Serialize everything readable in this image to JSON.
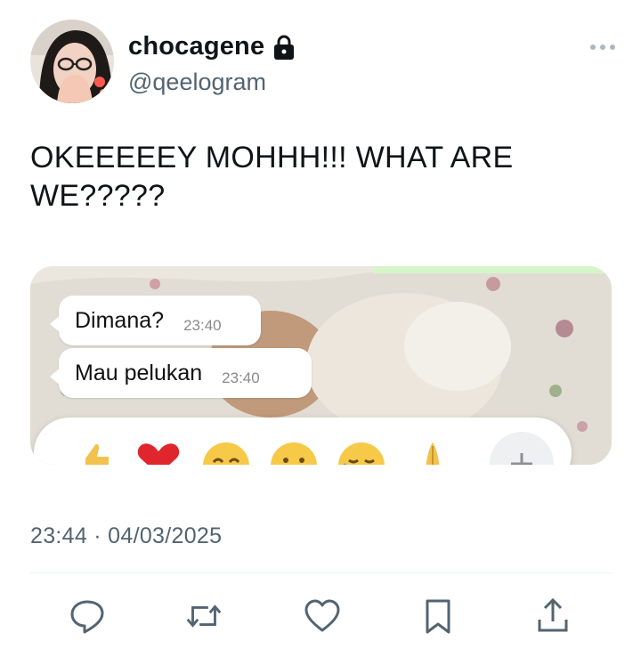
{
  "author": {
    "display_name": "chocagene",
    "handle": "@qeelogram",
    "avatar_icon": "avatar-photo",
    "protected_icon": "lock-icon"
  },
  "tweet": {
    "text": "OKEEEEEY MOHHH!!! WHAT ARE WE?????",
    "timestamp": "23:44 · 04/03/2025"
  },
  "media": {
    "messages": [
      {
        "text": "Dimana?",
        "time": "23:40"
      },
      {
        "text": "Mau pelukan",
        "time": "23:40"
      }
    ],
    "reactions": [
      "thumbs-up",
      "heart",
      "joy",
      "open-mouth",
      "crying",
      "folded-hands",
      "plus"
    ]
  },
  "actions": [
    "reply-icon",
    "retweet-icon",
    "like-icon",
    "bookmark-icon",
    "share-icon"
  ],
  "colors": {
    "text": "#0f1419",
    "secondary": "#536471",
    "icon": "#536471",
    "divider": "#eff3f4"
  }
}
